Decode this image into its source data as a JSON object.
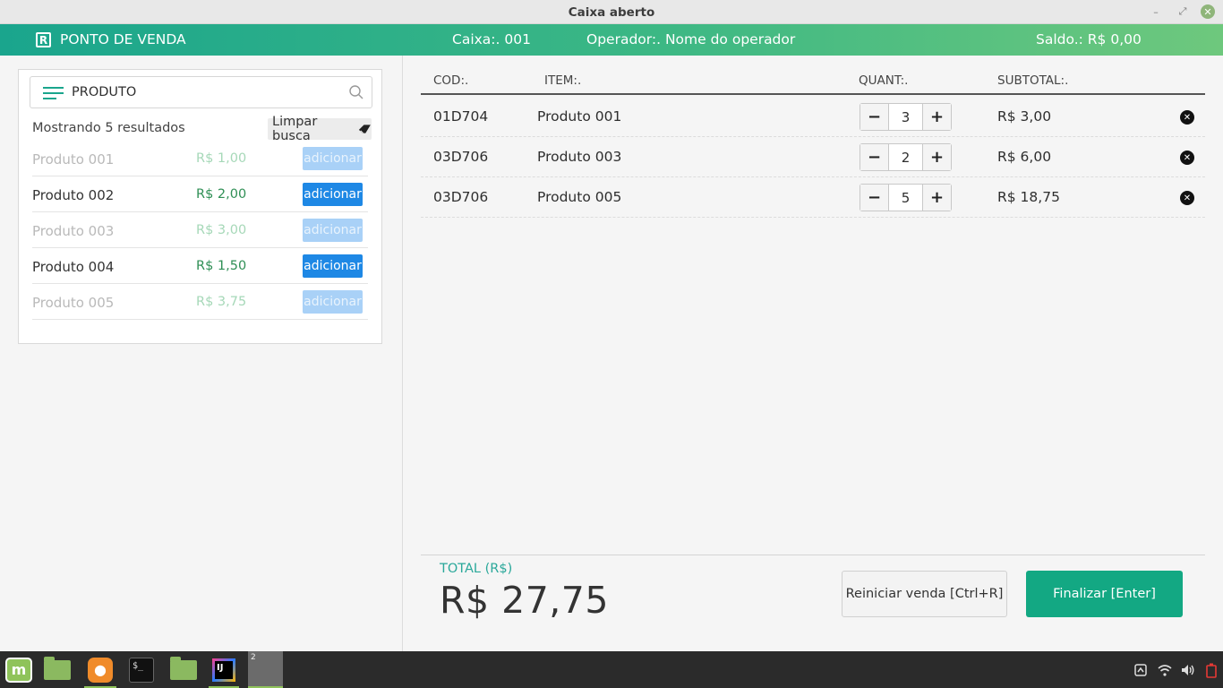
{
  "window": {
    "title": "Caixa aberto",
    "min_glyph": "–",
    "max_glyph": "⤢",
    "close_glyph": "✕"
  },
  "header": {
    "brand": "PONTO DE VENDA",
    "logo_letter": "R",
    "caixa": "Caixa:. 001",
    "operador": "Operador:. Nome do operador",
    "saldo": "Saldo.: R$ 0,00"
  },
  "search": {
    "value": "PRODUTO",
    "results_text": "Mostrando 5 resultados",
    "clear_label": "Limpar busca"
  },
  "products": [
    {
      "name": "Produto 001",
      "price": "R$ 1,00",
      "action": "adicionar",
      "enabled": false
    },
    {
      "name": "Produto 002",
      "price": "R$ 2,00",
      "action": "adicionar",
      "enabled": true
    },
    {
      "name": "Produto 003",
      "price": "R$ 3,00",
      "action": "adicionar",
      "enabled": false
    },
    {
      "name": "Produto 004",
      "price": "R$ 1,50",
      "action": "adicionar",
      "enabled": true
    },
    {
      "name": "Produto 005",
      "price": "R$ 3,75",
      "action": "adicionar",
      "enabled": false
    }
  ],
  "cart": {
    "headers": {
      "cod": "COD:.",
      "item": "ITEM:.",
      "quant": "QUANT:.",
      "subtotal": "SUBTOTAL:."
    },
    "stepper": {
      "minus": "−",
      "plus": "+"
    },
    "remove_glyph": "✕",
    "rows": [
      {
        "cod": "01D704",
        "item": "Produto 001",
        "qty": "3",
        "subtotal": "R$ 3,00"
      },
      {
        "cod": "03D706",
        "item": "Produto 003",
        "qty": "2",
        "subtotal": "R$ 6,00"
      },
      {
        "cod": "03D706",
        "item": "Produto 005",
        "qty": "5",
        "subtotal": "R$ 18,75"
      }
    ]
  },
  "totals": {
    "label": "TOTAL (R$)",
    "value": "R$ 27,75",
    "reset_label": "Reiniciar venda [Ctrl+R]",
    "finish_label": "Finalizar [Enter]"
  },
  "taskbar": {
    "mint_label": "m",
    "terminal_glyph": "$_",
    "ide_label": "IJ",
    "workspace_number": "2"
  },
  "colors": {
    "accent": "#1aa58d",
    "finish_button": "#13a883",
    "add_button": "#1e88e5",
    "price_green": "#2f8f55"
  }
}
